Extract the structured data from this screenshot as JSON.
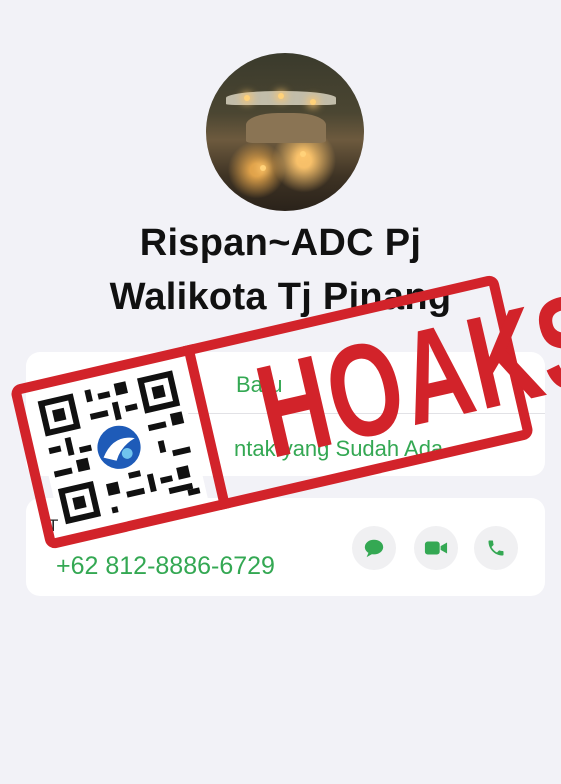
{
  "contact": {
    "name_line1": "Rispan~ADC Pj",
    "name_line2": "Walikota Tj Pinang"
  },
  "options": {
    "new_contact_label": "Baru",
    "existing_contact_label": "ntak yang Sudah Ada"
  },
  "phone": {
    "label": "T",
    "number": "+62 812-8886-6729"
  },
  "actions": {
    "message_icon": "message-icon",
    "video_icon": "video-icon",
    "call_icon": "phone-icon"
  },
  "stamp": {
    "text": "HOAKS",
    "color": "#d2232a"
  },
  "colors": {
    "accent": "#34a853",
    "background": "#f2f2f7",
    "card": "#ffffff"
  }
}
